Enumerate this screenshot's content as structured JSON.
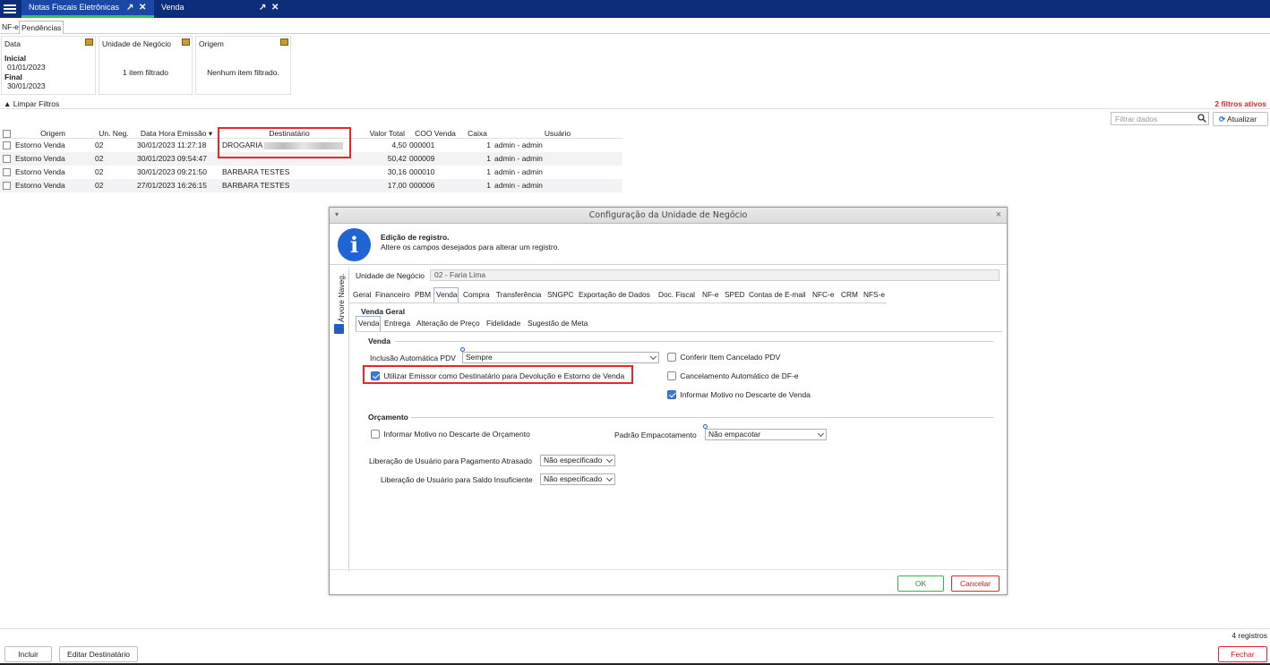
{
  "topbar": {
    "tabs": [
      {
        "label": "Notas Fiscais Eletrônicas"
      },
      {
        "label": "Venda"
      }
    ]
  },
  "subtabs": [
    "NF-e",
    "Pendências"
  ],
  "filters": {
    "data": {
      "title": "Data",
      "inicial_label": "Inicial",
      "inicial_value": "01/01/2023",
      "final_label": "Final",
      "final_value": "30/01/2023"
    },
    "unidade": {
      "title": "Unidade de Negócio",
      "text": "1 item filtrado"
    },
    "origem": {
      "title": "Origem",
      "text": "Nenhum item filtrado."
    },
    "limpar": "Limpar Filtros",
    "ativos": "2 filtros ativos",
    "search_placeholder": "Filtrar dados",
    "atualizar": "Atualizar"
  },
  "grid": {
    "headers": [
      "Origem",
      "Un. Neg.",
      "Data Hora Emissão",
      "Destinatário",
      "Valor Total",
      "COO Venda",
      "Caixa",
      "Usuário"
    ],
    "rows": [
      {
        "origem": "Estorno Venda",
        "un": "02",
        "data": "30/01/2023 11:27:18",
        "dest": "DROGARIA",
        "valor": "4,50",
        "coo": "000001",
        "caixa": "1",
        "usuario": "admin - admin"
      },
      {
        "origem": "Estorno Venda",
        "un": "02",
        "data": "30/01/2023 09:54:47",
        "dest": "",
        "valor": "50,42",
        "coo": "000009",
        "caixa": "1",
        "usuario": "admin - admin"
      },
      {
        "origem": "Estorno Venda",
        "un": "02",
        "data": "30/01/2023 09:21:50",
        "dest": "BARBARA TESTES",
        "valor": "30,16",
        "coo": "000010",
        "caixa": "1",
        "usuario": "admin - admin"
      },
      {
        "origem": "Estorno Venda",
        "un": "02",
        "data": "27/01/2023 16:26:15",
        "dest": "BARBARA TESTES",
        "valor": "17,00",
        "coo": "000006",
        "caixa": "1",
        "usuario": "admin - admin"
      }
    ]
  },
  "bottom": {
    "registros": "4 registros",
    "incluir": "Incluir",
    "editar": "Editar Destinatário",
    "fechar": "Fechar"
  },
  "dialog": {
    "title": "Configuração da Unidade de Negócio",
    "info_title": "Edição de registro.",
    "info_sub": "Altere os campos desejados para alterar um registro.",
    "arvore": "Árvore Naveg.",
    "un_label": "Unidade de Negócio",
    "un_value": "02 - Faria Lima",
    "tabs": [
      "Geral",
      "Financeiro",
      "PBM",
      "Venda",
      "Compra",
      "Transferência",
      "SNGPC",
      "Exportação de Dados",
      "Doc. Fiscal",
      "NF-e",
      "SPED",
      "Contas de E-mail",
      "NFC-e",
      "CRM",
      "NFS-e"
    ],
    "venda_geral": "Venda Geral",
    "subtabs": [
      "Venda",
      "Entrega",
      "Alteração de Preço",
      "Fidelidade",
      "Sugestão de Meta"
    ],
    "sec_venda": "Venda",
    "inclusao_label": "Inclusão Automática PDV",
    "inclusao_value": "Sempre",
    "conferir": "Conferir Item Cancelado PDV",
    "utilizar": "Utilizar Emissor como Destinatário para Devolução e Estorno de Venda",
    "cancelamento": "Cancelamento Automático de DF-e",
    "informar_venda": "Informar Motivo no Descarte de Venda",
    "sec_orcamento": "Orçamento",
    "informar_orc": "Informar Motivo no Descarte de Orçamento",
    "padrao_label": "Padrão Empacotamento",
    "padrao_value": "Não empacotar",
    "lib_pag_label": "Liberação de Usuário para Pagamento Atrasado",
    "lib_pag_value": "Não especificado",
    "lib_saldo_label": "Liberação de Usuário para Saldo Insuficiente",
    "lib_saldo_value": "Não especificado",
    "ok": "OK",
    "cancelar": "Cancelar"
  }
}
